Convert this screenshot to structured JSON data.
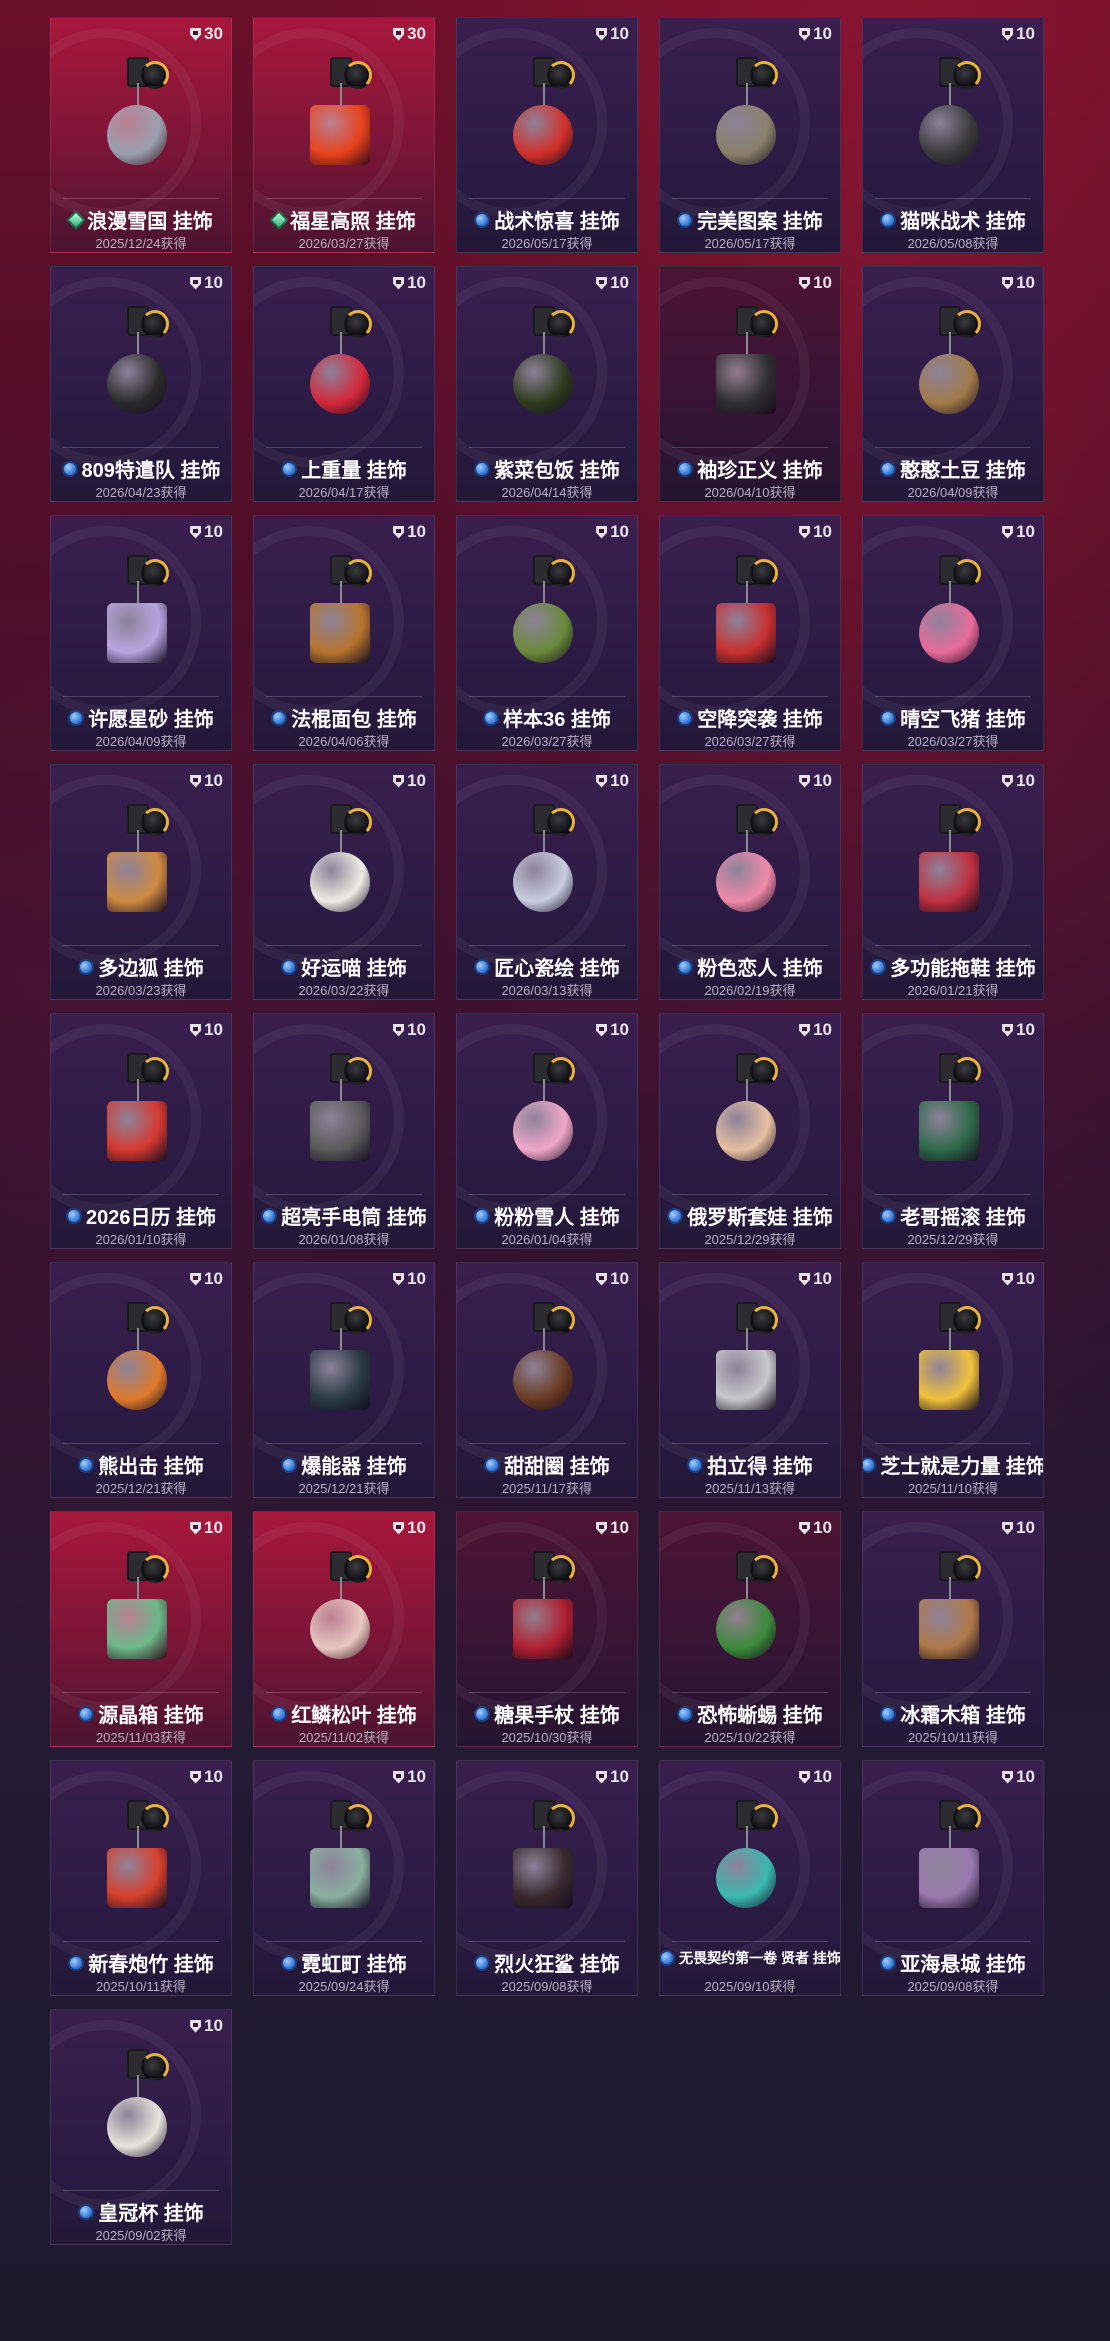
{
  "suffix": "获得",
  "badge_icon": "shield-icon",
  "items": [
    {
      "name": "浪漫雪国 挂饰",
      "date": "2025/12/24获得",
      "value": "30",
      "rarity": "green",
      "bg": "red",
      "color": "#9aa0b0",
      "shape": "circle"
    },
    {
      "name": "福星高照 挂饰",
      "date": "2026/03/27获得",
      "value": "30",
      "rarity": "green",
      "bg": "red",
      "color": "#e8431c",
      "shape": "rect"
    },
    {
      "name": "战术惊喜 挂饰",
      "date": "2026/05/17获得",
      "value": "10",
      "rarity": "blue",
      "bg": "purple",
      "color": "#d2302a",
      "shape": "circle"
    },
    {
      "name": "完美图案 挂饰",
      "date": "2026/05/17获得",
      "value": "10",
      "rarity": "blue",
      "bg": "purple",
      "color": "#8a8068",
      "shape": "circle"
    },
    {
      "name": "猫咪战术 挂饰",
      "date": "2026/05/08获得",
      "value": "10",
      "rarity": "blue",
      "bg": "purple",
      "color": "#3a3a3a",
      "shape": "circle"
    },
    {
      "name": "809特遣队 挂饰",
      "date": "2026/04/23获得",
      "value": "10",
      "rarity": "blue",
      "bg": "purple",
      "color": "#2a2a2a",
      "shape": "circle"
    },
    {
      "name": "上重量 挂饰",
      "date": "2026/04/17获得",
      "value": "10",
      "rarity": "blue",
      "bg": "purple",
      "color": "#d3283a",
      "shape": "circle"
    },
    {
      "name": "紫菜包饭 挂饰",
      "date": "2026/04/14获得",
      "value": "10",
      "rarity": "blue",
      "bg": "purple",
      "color": "#2e3a1c",
      "shape": "circle"
    },
    {
      "name": "袖珍正义 挂饰",
      "date": "2026/04/10获得",
      "value": "10",
      "rarity": "blue",
      "bg": "dark",
      "color": "#2f2f33",
      "shape": "rect"
    },
    {
      "name": "憨憨土豆 挂饰",
      "date": "2026/04/09获得",
      "value": "10",
      "rarity": "blue",
      "bg": "purple",
      "color": "#a27a48",
      "shape": "circle"
    },
    {
      "name": "许愿星砂 挂饰",
      "date": "2026/04/09获得",
      "value": "10",
      "rarity": "blue",
      "bg": "purple",
      "color": "#b9a4e0",
      "shape": "rect"
    },
    {
      "name": "法棍面包 挂饰",
      "date": "2026/04/06获得",
      "value": "10",
      "rarity": "blue",
      "bg": "purple",
      "color": "#b7742c",
      "shape": "rect"
    },
    {
      "name": "样本36 挂饰",
      "date": "2026/03/27获得",
      "value": "10",
      "rarity": "blue",
      "bg": "purple",
      "color": "#6a8a3a",
      "shape": "circle"
    },
    {
      "name": "空降突袭 挂饰",
      "date": "2026/03/27获得",
      "value": "10",
      "rarity": "blue",
      "bg": "purple",
      "color": "#c83030",
      "shape": "rect"
    },
    {
      "name": "晴空飞猪 挂饰",
      "date": "2026/03/27获得",
      "value": "10",
      "rarity": "blue",
      "bg": "purple",
      "color": "#ea6a9a",
      "shape": "circle"
    },
    {
      "name": "多边狐 挂饰",
      "date": "2026/03/23获得",
      "value": "10",
      "rarity": "blue",
      "bg": "purple",
      "color": "#d08a40",
      "shape": "rect"
    },
    {
      "name": "好运喵 挂饰",
      "date": "2026/03/22获得",
      "value": "10",
      "rarity": "blue",
      "bg": "purple",
      "color": "#f0ece4",
      "shape": "circle"
    },
    {
      "name": "匠心瓷绘 挂饰",
      "date": "2026/03/13获得",
      "value": "10",
      "rarity": "blue",
      "bg": "purple",
      "color": "#c9cde0",
      "shape": "circle"
    },
    {
      "name": "粉色恋人 挂饰",
      "date": "2026/02/19获得",
      "value": "10",
      "rarity": "blue",
      "bg": "purple",
      "color": "#f08aa8",
      "shape": "circle"
    },
    {
      "name": "多功能拖鞋 挂饰",
      "date": "2026/01/21获得",
      "value": "10",
      "rarity": "blue",
      "bg": "purple",
      "color": "#c03040",
      "shape": "rect"
    },
    {
      "name": "2026日历 挂饰",
      "date": "2026/01/10获得",
      "value": "10",
      "rarity": "blue",
      "bg": "purple",
      "color": "#d63a30",
      "shape": "rect"
    },
    {
      "name": "超亮手电筒 挂饰",
      "date": "2026/01/08获得",
      "value": "10",
      "rarity": "blue",
      "bg": "purple",
      "color": "#5a5a5a",
      "shape": "rect"
    },
    {
      "name": "粉粉雪人 挂饰",
      "date": "2026/01/04获得",
      "value": "10",
      "rarity": "blue",
      "bg": "purple",
      "color": "#f0a8c8",
      "shape": "circle"
    },
    {
      "name": "俄罗斯套娃 挂饰",
      "date": "2025/12/29获得",
      "value": "10",
      "rarity": "blue",
      "bg": "purple",
      "color": "#e8c0a0",
      "shape": "circle"
    },
    {
      "name": "老哥摇滚 挂饰",
      "date": "2025/12/29获得",
      "value": "10",
      "rarity": "blue",
      "bg": "purple",
      "color": "#2e6a4a",
      "shape": "rect"
    },
    {
      "name": "熊出击 挂饰",
      "date": "2025/12/21获得",
      "value": "10",
      "rarity": "blue",
      "bg": "purple",
      "color": "#e07a2a",
      "shape": "circle"
    },
    {
      "name": "爆能器 挂饰",
      "date": "2025/12/21获得",
      "value": "10",
      "rarity": "blue",
      "bg": "purple",
      "color": "#2a3a44",
      "shape": "rect"
    },
    {
      "name": "甜甜圈 挂饰",
      "date": "2025/11/17获得",
      "value": "10",
      "rarity": "blue",
      "bg": "purple",
      "color": "#6a3a22",
      "shape": "circle"
    },
    {
      "name": "拍立得 挂饰",
      "date": "2025/11/13获得",
      "value": "10",
      "rarity": "blue",
      "bg": "purple",
      "color": "#c8c8cc",
      "shape": "rect"
    },
    {
      "name": "芝士就是力量 挂饰",
      "date": "2025/11/10获得",
      "value": "10",
      "rarity": "blue",
      "bg": "purple",
      "color": "#f2c23a",
      "shape": "rect"
    },
    {
      "name": "源晶箱 挂饰",
      "date": "2025/11/03获得",
      "value": "10",
      "rarity": "blue",
      "bg": "red",
      "color": "#6ab88a",
      "shape": "rect"
    },
    {
      "name": "红鳞松叶 挂饰",
      "date": "2025/11/02获得",
      "value": "10",
      "rarity": "blue",
      "bg": "red",
      "color": "#e8c8c0",
      "shape": "circle"
    },
    {
      "name": "糖果手杖 挂饰",
      "date": "2025/10/30获得",
      "value": "10",
      "rarity": "blue",
      "bg": "dark",
      "color": "#b02030",
      "shape": "rect"
    },
    {
      "name": "恐怖蜥蜴 挂饰",
      "date": "2025/10/22获得",
      "value": "10",
      "rarity": "blue",
      "bg": "dark",
      "color": "#3a8a3a",
      "shape": "circle"
    },
    {
      "name": "冰霜木箱 挂饰",
      "date": "2025/10/11获得",
      "value": "10",
      "rarity": "blue",
      "bg": "purple",
      "color": "#b07a48",
      "shape": "rect"
    },
    {
      "name": "新春炮竹 挂饰",
      "date": "2025/10/11获得",
      "value": "10",
      "rarity": "blue",
      "bg": "purple",
      "color": "#d8402c",
      "shape": "rect"
    },
    {
      "name": "霓虹町 挂饰",
      "date": "2025/09/24获得",
      "value": "10",
      "rarity": "blue",
      "bg": "purple",
      "color": "#8ab0a0",
      "shape": "rect"
    },
    {
      "name": "烈火狂鲨 挂饰",
      "date": "2025/09/08获得",
      "value": "10",
      "rarity": "blue",
      "bg": "purple",
      "color": "#3a2a2e",
      "shape": "rect"
    },
    {
      "name": "无畏契约第一卷 贤者 挂饰",
      "date": "2025/09/10获得",
      "value": "10",
      "rarity": "blue",
      "bg": "purple",
      "color": "#3ab8b0",
      "shape": "circle",
      "small": true
    },
    {
      "name": "亚海悬城 挂饰",
      "date": "2025/09/08获得",
      "value": "10",
      "rarity": "blue",
      "bg": "purple",
      "color": "#9a7ab0",
      "shape": "rect"
    },
    {
      "name": "皇冠杯 挂饰",
      "date": "2025/09/02获得",
      "value": "10",
      "rarity": "blue",
      "bg": "purple",
      "color": "#e8e4dc",
      "shape": "circle"
    }
  ]
}
